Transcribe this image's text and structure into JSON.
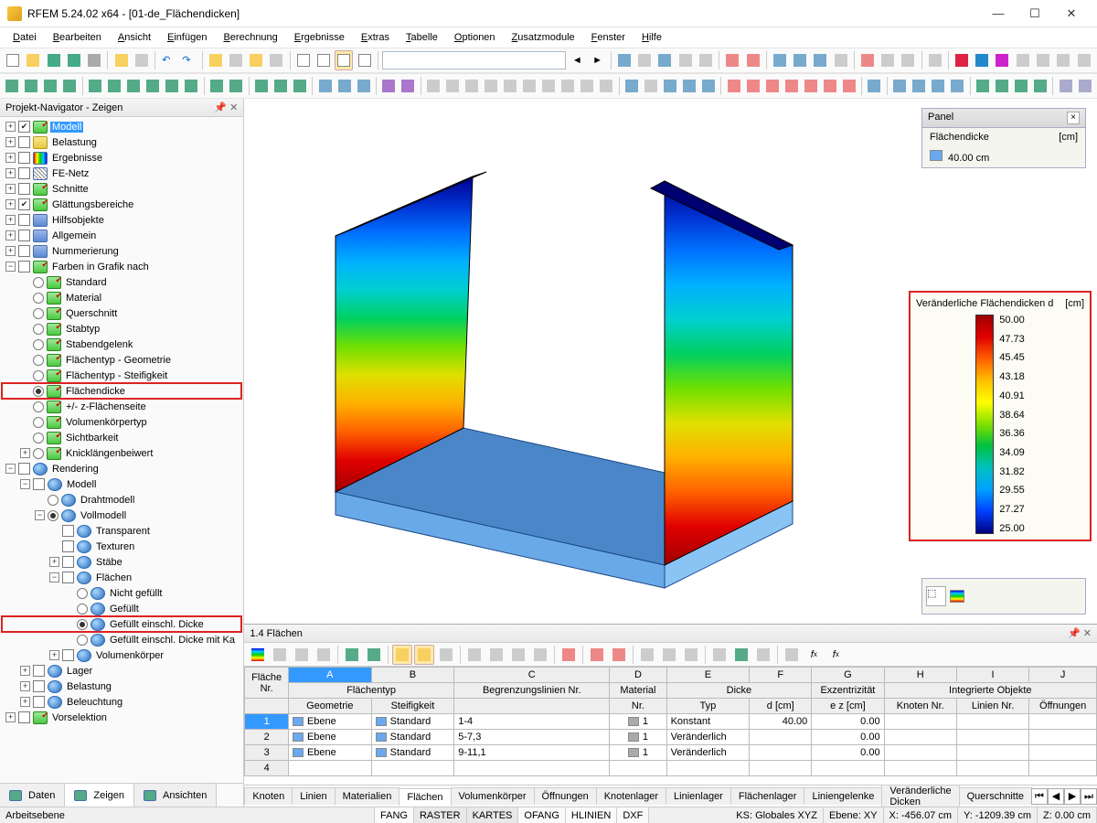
{
  "titlebar": {
    "title": "RFEM 5.24.02 x64 - [01-de_Flächendicken]"
  },
  "menubar": [
    "Datei",
    "Bearbeiten",
    "Ansicht",
    "Einfügen",
    "Berechnung",
    "Ergebnisse",
    "Extras",
    "Tabelle",
    "Optionen",
    "Zusatzmodule",
    "Fenster",
    "Hilfe"
  ],
  "navigator": {
    "title": "Projekt-Navigator - Zeigen",
    "tabs": [
      {
        "label": "Daten",
        "active": false
      },
      {
        "label": "Zeigen",
        "active": true
      },
      {
        "label": "Ansichten",
        "active": false
      }
    ],
    "items": [
      {
        "ind": 0,
        "exp": "+",
        "chk": true,
        "ico": "green",
        "label": "Modell",
        "hilite": true
      },
      {
        "ind": 0,
        "exp": "+",
        "chk": false,
        "ico": "yellow",
        "label": "Belastung"
      },
      {
        "ind": 0,
        "exp": "+",
        "chk": false,
        "ico": "rb",
        "label": "Ergebnisse"
      },
      {
        "ind": 0,
        "exp": "+",
        "chk": false,
        "ico": "mesh",
        "label": "FE-Netz"
      },
      {
        "ind": 0,
        "exp": "+",
        "chk": false,
        "ico": "green",
        "label": "Schnitte"
      },
      {
        "ind": 0,
        "exp": "+",
        "chk": true,
        "ico": "green",
        "label": "Glättungsbereiche"
      },
      {
        "ind": 0,
        "exp": "+",
        "chk": false,
        "ico": "blue",
        "label": "Hilfsobjekte"
      },
      {
        "ind": 0,
        "exp": "+",
        "chk": false,
        "ico": "blue",
        "label": "Allgemein"
      },
      {
        "ind": 0,
        "exp": "+",
        "chk": false,
        "ico": "blue",
        "label": "Nummerierung"
      },
      {
        "ind": 0,
        "exp": "-",
        "chk": false,
        "ico": "green",
        "label": "Farben in Grafik nach"
      },
      {
        "ind": 1,
        "rad": false,
        "ico": "green",
        "label": "Standard"
      },
      {
        "ind": 1,
        "rad": false,
        "ico": "green",
        "label": "Material"
      },
      {
        "ind": 1,
        "rad": false,
        "ico": "green",
        "label": "Querschnitt"
      },
      {
        "ind": 1,
        "rad": false,
        "ico": "green",
        "label": "Stabtyp"
      },
      {
        "ind": 1,
        "rad": false,
        "ico": "green",
        "label": "Stabendgelenk"
      },
      {
        "ind": 1,
        "rad": false,
        "ico": "green",
        "label": "Flächentyp - Geometrie"
      },
      {
        "ind": 1,
        "rad": false,
        "ico": "green",
        "label": "Flächentyp - Steifigkeit"
      },
      {
        "ind": 1,
        "rad": true,
        "ico": "green",
        "label": "Flächendicke",
        "red": true
      },
      {
        "ind": 1,
        "rad": false,
        "ico": "green",
        "label": "+/- z-Flächenseite"
      },
      {
        "ind": 1,
        "rad": false,
        "ico": "green",
        "label": "Volumenkörpertyp"
      },
      {
        "ind": 1,
        "rad": false,
        "ico": "green",
        "label": "Sichtbarkeit"
      },
      {
        "ind": 1,
        "exp": "+",
        "rad": false,
        "ico": "green",
        "label": "Knicklängenbeiwert"
      },
      {
        "ind": 0,
        "exp": "-",
        "chk": false,
        "ico": "sphere",
        "label": "Rendering"
      },
      {
        "ind": 1,
        "exp": "-",
        "chk": false,
        "ico": "sphere",
        "label": "Modell"
      },
      {
        "ind": 2,
        "rad": false,
        "ico": "sphere",
        "label": "Drahtmodell"
      },
      {
        "ind": 2,
        "exp": "-",
        "rad": true,
        "ico": "sphere",
        "label": "Vollmodell"
      },
      {
        "ind": 3,
        "chk": false,
        "ico": "sphere",
        "label": "Transparent"
      },
      {
        "ind": 3,
        "chk": false,
        "ico": "sphere",
        "label": "Texturen"
      },
      {
        "ind": 3,
        "exp": "+",
        "chk": false,
        "ico": "sphere",
        "label": "Stäbe"
      },
      {
        "ind": 3,
        "exp": "-",
        "chk": false,
        "ico": "sphere",
        "label": "Flächen"
      },
      {
        "ind": 4,
        "rad": false,
        "ico": "sphere",
        "label": "Nicht gefüllt"
      },
      {
        "ind": 4,
        "rad": false,
        "ico": "sphere",
        "label": "Gefüllt"
      },
      {
        "ind": 4,
        "rad": true,
        "ico": "sphere",
        "label": "Gefüllt einschl. Dicke",
        "red": true
      },
      {
        "ind": 4,
        "rad": false,
        "ico": "sphere",
        "label": "Gefüllt einschl. Dicke mit Ka"
      },
      {
        "ind": 3,
        "exp": "+",
        "chk": false,
        "ico": "sphere",
        "label": "Volumenkörper"
      },
      {
        "ind": 1,
        "exp": "+",
        "chk": false,
        "ico": "sphere",
        "label": "Lager"
      },
      {
        "ind": 1,
        "exp": "+",
        "chk": false,
        "ico": "sphere",
        "label": "Belastung"
      },
      {
        "ind": 1,
        "exp": "+",
        "chk": false,
        "ico": "sphere",
        "label": "Beleuchtung"
      },
      {
        "ind": 0,
        "exp": "+",
        "chk": false,
        "ico": "green",
        "label": "Vorselektion"
      }
    ]
  },
  "panel": {
    "title": "Panel",
    "subtitle": "Flächendicke",
    "unit": "[cm]",
    "value": "40.00 cm"
  },
  "legend": {
    "title": "Veränderliche Flächendicken d",
    "unit": "[cm]",
    "values": [
      "50.00",
      "47.73",
      "45.45",
      "43.18",
      "40.91",
      "38.64",
      "36.36",
      "34.09",
      "31.82",
      "29.55",
      "27.27",
      "25.00"
    ]
  },
  "table": {
    "title": "1.4 Flächen",
    "header1": {
      "flaeche": "Fläche",
      "nr": "Nr.",
      "flaechentyp": "Flächentyp",
      "geometrie": "Geometrie",
      "steifigkeit": "Steifigkeit",
      "begrenzung": "Begrenzungslinien Nr.",
      "material": "Material",
      "matNr": "Nr.",
      "dicke": "Dicke",
      "typ": "Typ",
      "dcm": "d [cm]",
      "exz": "Exzentrizität",
      "ez": "e z [cm]",
      "integ": "Integrierte Objekte",
      "knoten": "Knoten Nr.",
      "linien": "Linien Nr.",
      "oeff": "Öffnungen"
    },
    "cols": [
      "A",
      "B",
      "C",
      "D",
      "E",
      "F",
      "G",
      "H",
      "I",
      "J"
    ],
    "rows": [
      {
        "nr": "1",
        "geo": "Ebene",
        "steif": "Standard",
        "begr": "1-4",
        "mat": "1",
        "typ": "Konstant",
        "d": "40.00",
        "ez": "0.00",
        "sel": true
      },
      {
        "nr": "2",
        "geo": "Ebene",
        "steif": "Standard",
        "begr": "5-7,3",
        "mat": "1",
        "typ": "Veränderlich",
        "d": "",
        "ez": "0.00"
      },
      {
        "nr": "3",
        "geo": "Ebene",
        "steif": "Standard",
        "begr": "9-11,1",
        "mat": "1",
        "typ": "Veränderlich",
        "d": "",
        "ez": "0.00"
      },
      {
        "nr": "4",
        "geo": "",
        "steif": "",
        "begr": "",
        "mat": "",
        "typ": "",
        "d": "",
        "ez": ""
      }
    ],
    "tabs": [
      "Knoten",
      "Linien",
      "Materialien",
      "Flächen",
      "Volumenkörper",
      "Öffnungen",
      "Knotenlager",
      "Linienlager",
      "Flächenlager",
      "Liniengelenke",
      "Veränderliche Dicken",
      "Querschnitte"
    ]
  },
  "statusbar": {
    "left": "Arbeitsebene",
    "btns": [
      "FANG",
      "RASTER",
      "KARTES",
      "OFANG",
      "HLINIEN",
      "DXF"
    ],
    "ks": "KS: Globales XYZ",
    "ebene": "Ebene: XY",
    "x": "X: -456.07 cm",
    "y": "Y: -1209.39 cm",
    "z": "Z: 0.00 cm"
  }
}
